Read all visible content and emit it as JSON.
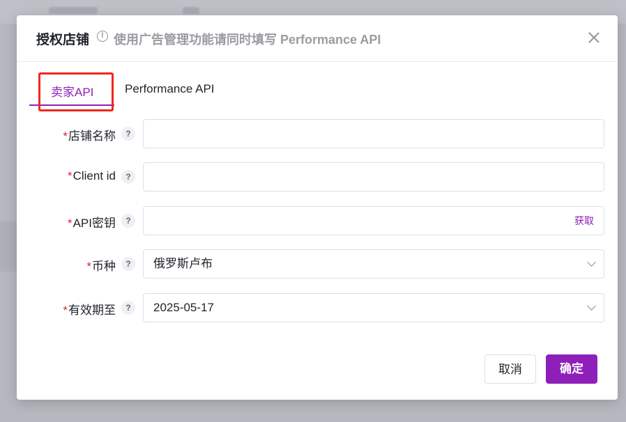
{
  "dialog": {
    "title": "授权店铺",
    "info_icon": "!",
    "subtitle": "使用广告管理功能请同时填写 Performance API"
  },
  "tabs": [
    {
      "label": "卖家API",
      "active": true
    },
    {
      "label": "Performance API",
      "active": false
    }
  ],
  "form": {
    "required_mark": "*",
    "help_icon": "?",
    "fields": [
      {
        "label": "店铺名称",
        "value": ""
      },
      {
        "label": "Client id",
        "value": ""
      },
      {
        "label": "API密钥",
        "value": "",
        "action": "获取"
      },
      {
        "label": "币种",
        "value": "俄罗斯卢布"
      },
      {
        "label": "有效期至",
        "value": "2025-05-17"
      }
    ]
  },
  "footer": {
    "cancel_label": "取消",
    "ok_label": "确定"
  },
  "colors": {
    "accent": "#8e1fb8",
    "required": "#e0242f",
    "highlight": "#f0261b"
  },
  "icons": [
    "info-icon",
    "close-icon",
    "help-icon",
    "chevron-down-icon"
  ]
}
